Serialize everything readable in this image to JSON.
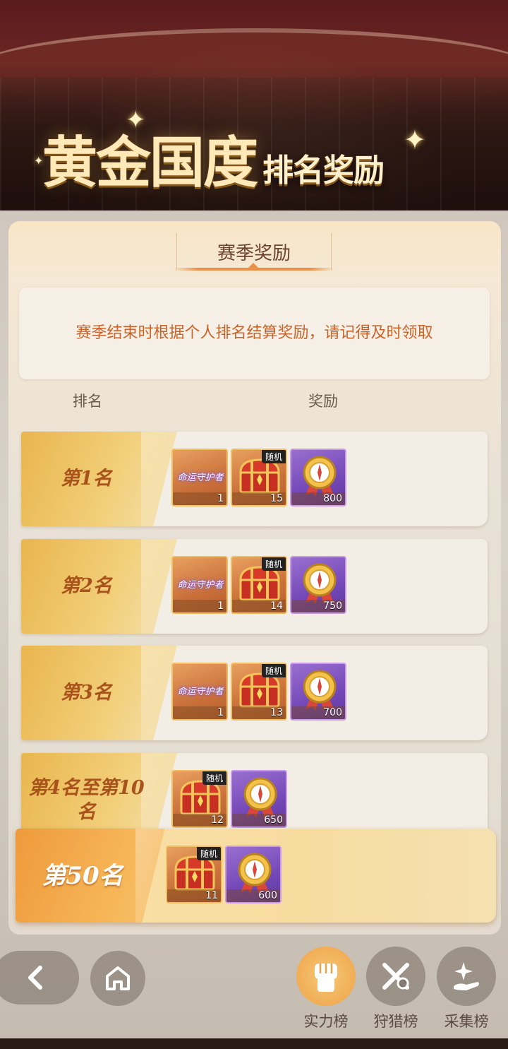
{
  "header": {
    "title_main": "黄金国度",
    "title_sub": "排名奖励"
  },
  "tab": {
    "label": "赛季奖励"
  },
  "notice": {
    "text": "赛季结束时根据个人排名结算奖励，请记得及时领取"
  },
  "columns": {
    "rank": "排名",
    "reward": "奖励"
  },
  "card_item_text": "命运守护者",
  "random_badge": "随机",
  "ranks": [
    {
      "label": "第1名",
      "items": [
        {
          "type": "card",
          "count": "1"
        },
        {
          "type": "chest",
          "count": "15",
          "random": true
        },
        {
          "type": "medal",
          "count": "800"
        }
      ]
    },
    {
      "label": "第2名",
      "items": [
        {
          "type": "card",
          "count": "1"
        },
        {
          "type": "chest",
          "count": "14",
          "random": true
        },
        {
          "type": "medal",
          "count": "750"
        }
      ]
    },
    {
      "label": "第3名",
      "items": [
        {
          "type": "card",
          "count": "1"
        },
        {
          "type": "chest",
          "count": "13",
          "random": true
        },
        {
          "type": "medal",
          "count": "700"
        }
      ]
    },
    {
      "label": "第4名至第10名",
      "items": [
        {
          "type": "chest",
          "count": "12",
          "random": true
        },
        {
          "type": "medal",
          "count": "650"
        }
      ]
    }
  ],
  "my_rank": {
    "label": "第50名",
    "items": [
      {
        "type": "chest",
        "count": "11",
        "random": true
      },
      {
        "type": "medal",
        "count": "600"
      }
    ]
  },
  "nav": {
    "tabs": [
      {
        "label": "实力榜",
        "active": true,
        "icon": "fist-icon"
      },
      {
        "label": "狩猎榜",
        "active": false,
        "icon": "crossed-swords-icon"
      },
      {
        "label": "采集榜",
        "active": false,
        "icon": "sparkle-hand-icon"
      }
    ]
  }
}
